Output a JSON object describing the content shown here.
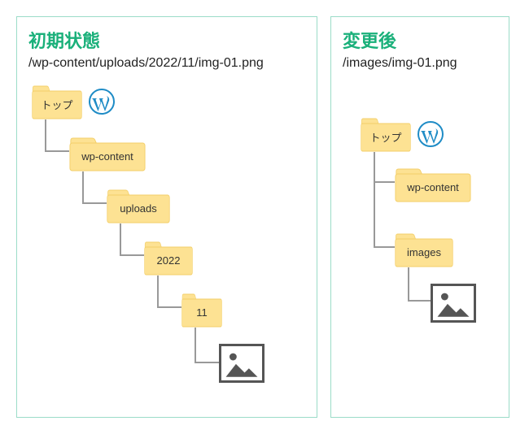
{
  "left_panel": {
    "title": "初期状態",
    "path": "/wp-content/uploads/2022/11/img-01.png",
    "tree": {
      "root": "トップ",
      "folders": [
        "wp-content",
        "uploads",
        "2022",
        "11"
      ]
    }
  },
  "right_panel": {
    "title": "変更後",
    "path": "/images/img-01.png",
    "tree": {
      "root": "トップ",
      "folders": [
        "wp-content",
        "images"
      ]
    }
  },
  "icons": {
    "wordpress": "wordpress-logo",
    "image_file": "image-file"
  },
  "colors": {
    "border": "#9bdcc8",
    "title": "#1ab07a",
    "folder_fill": "#fde293",
    "folder_stroke": "#f3cf6a",
    "wp_blue": "#1f8cc6",
    "connector": "#999999",
    "img_border": "#555555"
  }
}
